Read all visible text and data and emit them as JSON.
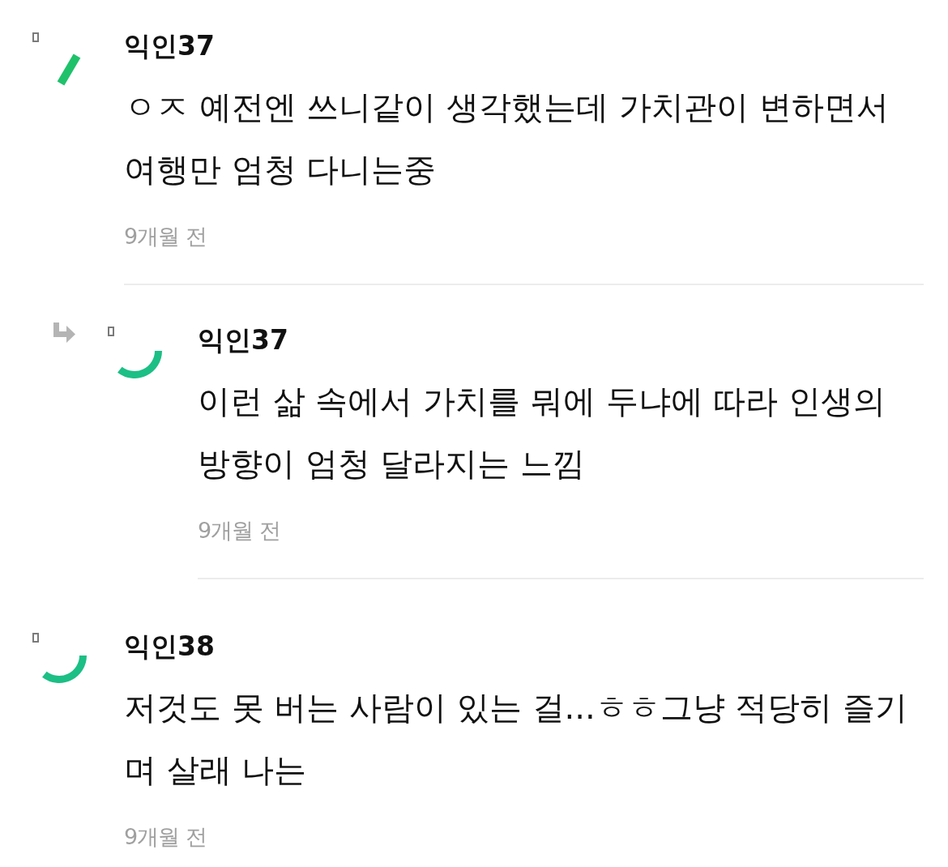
{
  "comments": [
    {
      "kind": "comment",
      "avatar": {
        "kind": "dash"
      },
      "author": "익인37",
      "text": "ㅇㅈ 예전엔 쓰니같이 생각했는데 가치관이 변하면서 여행만 엄청 다니는중",
      "time": "9개월 전"
    },
    {
      "kind": "reply",
      "avatar": {
        "kind": "arc"
      },
      "author": "익인37",
      "text": "이런 삶 속에서 가치를 뭐에 두냐에 따라 인생의 방향이 엄청 달라지는 느낌",
      "time": "9개월 전"
    },
    {
      "kind": "comment",
      "avatar": {
        "kind": "arc"
      },
      "author": "익인38",
      "text": "저것도 못 버는 사람이 있는 걸...ㅎㅎ그냥 적당히 즐기며 살래 나는",
      "time": "9개월 전"
    }
  ]
}
